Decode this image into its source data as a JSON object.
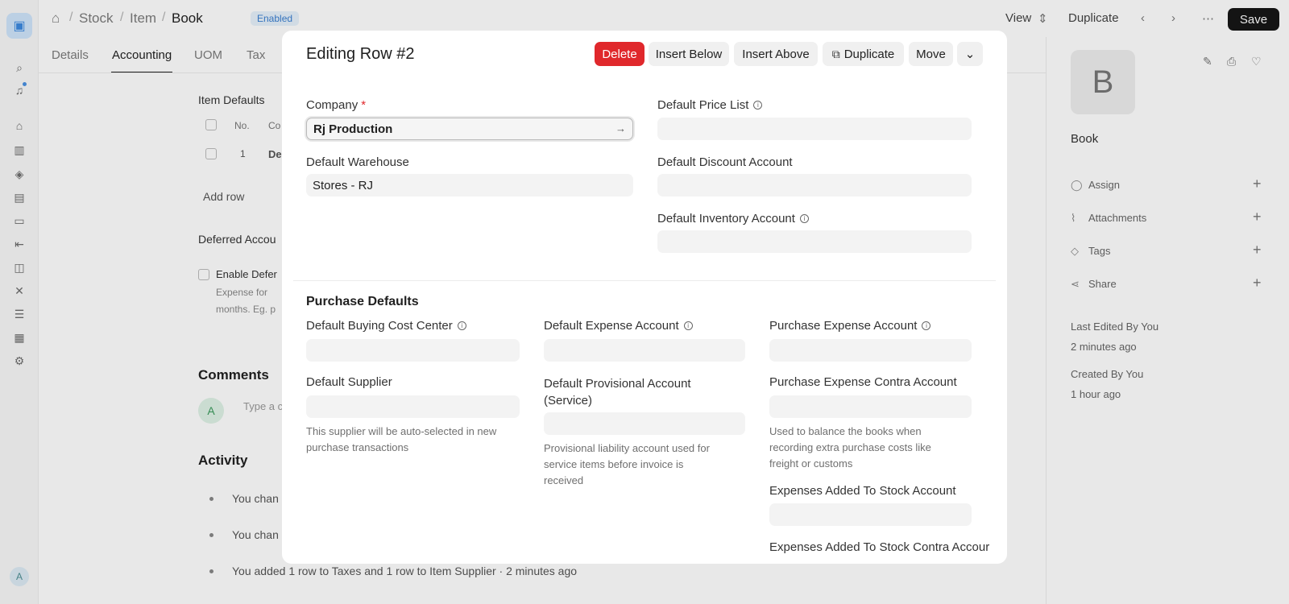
{
  "sidebar": {
    "logo_icon": "app-logo-icon",
    "avatar_letter": "A"
  },
  "breadcrumb": {
    "items": [
      "Stock",
      "Item",
      "Book"
    ],
    "separator": "/",
    "status_badge": "Enabled"
  },
  "toolbar": {
    "view_label": "View",
    "duplicate_label": "Duplicate",
    "save_label": "Save"
  },
  "tabs": [
    "Details",
    "Accounting",
    "UOM",
    "Tax"
  ],
  "background": {
    "item_defaults_title": "Item Defaults",
    "table_headers": [
      "No.",
      "Co"
    ],
    "table_row_no": "1",
    "table_row_company": "De",
    "add_row_label": "Add row",
    "deferred_title": "Deferred Accou",
    "enable_deferred_label": "Enable Defer",
    "deferred_help_1": "Expense for",
    "deferred_help_2": "months. Eg. p",
    "comments_title": "Comments",
    "comment_avatar": "A",
    "comment_placeholder": "Type a c",
    "activity_title": "Activity",
    "activity_items": [
      "You chan",
      "You chan",
      "You added 1 row to Taxes and 1 row to Item Supplier · 2 minutes ago"
    ]
  },
  "right_panel": {
    "avatar_letter": "B",
    "item_name": "Book",
    "actions": [
      "Assign",
      "Attachments",
      "Tags",
      "Share"
    ],
    "last_edited": "Last Edited By You",
    "last_edited_time": "2 minutes ago",
    "created": "Created By You",
    "created_time": "1 hour ago"
  },
  "dialog": {
    "title": "Editing Row #2",
    "buttons": {
      "delete": "Delete",
      "insert_below": "Insert Below",
      "insert_above": "Insert Above",
      "duplicate": "Duplicate",
      "move": "Move"
    },
    "fields": {
      "company_label": "Company",
      "company_value": "Rj Production",
      "default_price_list_label": "Default Price List",
      "default_warehouse_label": "Default Warehouse",
      "default_warehouse_value": "Stores - RJ",
      "default_discount_account_label": "Default Discount Account",
      "default_inventory_account_label": "Default Inventory Account"
    },
    "purchase_defaults": {
      "title": "Purchase Defaults",
      "default_buying_cost_center_label": "Default Buying Cost Center",
      "default_expense_account_label": "Default Expense Account",
      "purchase_expense_account_label": "Purchase Expense Account",
      "default_supplier_label": "Default Supplier",
      "default_supplier_help_1": "This supplier will be auto-selected in new",
      "default_supplier_help_2": "purchase transactions",
      "default_provisional_account_label_1": "Default Provisional Account",
      "default_provisional_account_label_2": "(Service)",
      "provisional_help_1": "Provisional liability account used for",
      "provisional_help_2": "service items before invoice is",
      "provisional_help_3": "received",
      "purchase_expense_contra_label": "Purchase Expense Contra Account",
      "contra_help_1": "Used to balance the books when",
      "contra_help_2": "recording extra purchase costs like",
      "contra_help_3": "freight or customs",
      "expenses_added_label": "Expenses Added To Stock Account",
      "expenses_added_contra_label": "Expenses Added To Stock Contra Accour"
    }
  }
}
